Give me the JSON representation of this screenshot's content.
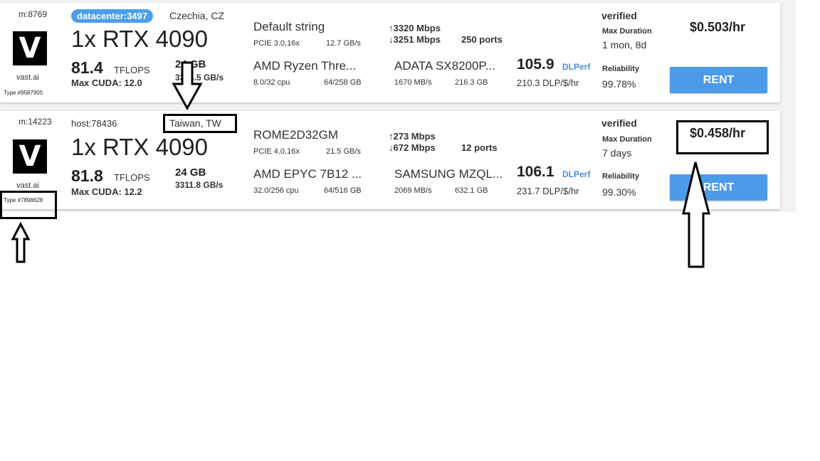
{
  "offers": [
    {
      "machine_id": "m:8769",
      "host_badge": "datacenter:3497",
      "location": "Czechia, CZ",
      "gpu_title": "1x RTX 4090",
      "tflops_value": "81.4",
      "tflops_unit": "TFLOPS",
      "max_cuda": "Max CUDA: 12.0",
      "vram": "24 GB",
      "vram_bw": "3324.5 GB/s",
      "logo_letter": "V",
      "logo_text": "vast.ai",
      "type_id": "Type #9587905",
      "motherboard": "Default string",
      "pcie": "PCIE 3.0,16x",
      "pcie_bw": "12.7 GB/s",
      "cpu_name": "AMD Ryzen Thre...",
      "cpu_cores": "8.0/32 cpu",
      "ram": "64/258 GB",
      "net_up": "3320 Mbps",
      "net_down": "3251 Mbps",
      "ports": "250 ports",
      "disk_name": "ADATA SX8200P...",
      "disk_speed": "1670 MB/s",
      "disk_size": "216.3 GB",
      "dlperf_value": "105.9",
      "dlperf_label": "DLPerf",
      "dlp_per_dollar": "210.3 DLP/$/hr",
      "verified": "verified",
      "max_duration_label": "Max Duration",
      "max_duration": "1 mon, 8d",
      "reliability_label": "Reliability",
      "reliability": "99.78%",
      "price": "$0.503/hr",
      "rent_label": "RENT"
    },
    {
      "machine_id": "m:14223",
      "host_label": "host:78436",
      "location": "Taiwan, TW",
      "gpu_title": "1x RTX 4090",
      "tflops_value": "81.8",
      "tflops_unit": "TFLOPS",
      "max_cuda": "Max CUDA: 12.2",
      "vram": "24 GB",
      "vram_bw": "3311.8 GB/s",
      "logo_letter": "V",
      "logo_text": "vast.ai",
      "type_id": "Type #7898628",
      "motherboard": "ROME2D32GM",
      "pcie": "PCIE 4.0,16x",
      "pcie_bw": "21.5 GB/s",
      "cpu_name": "AMD EPYC 7B12 ...",
      "cpu_cores": "32.0/256 cpu",
      "ram": "64/516 GB",
      "net_up": "273 Mbps",
      "net_down": "672 Mbps",
      "ports": "12 ports",
      "disk_name": "SAMSUNG MZQL...",
      "disk_speed": "2069 MB/s",
      "disk_size": "632.1 GB",
      "dlperf_value": "106.1",
      "dlperf_label": "DLPerf",
      "dlp_per_dollar": "231.7 DLP/$/hr",
      "verified": "verified",
      "max_duration_label": "Max Duration",
      "max_duration": "7 days",
      "reliability_label": "Reliability",
      "reliability": "99.30%",
      "price": "$0.458/hr",
      "rent_label": "RENT"
    }
  ],
  "icons": {
    "arrow_up": "↑",
    "arrow_down": "↓"
  },
  "colors": {
    "accent": "#4d9be6",
    "badge": "#4c9ee8",
    "dlperf": "#4d8fd8"
  }
}
